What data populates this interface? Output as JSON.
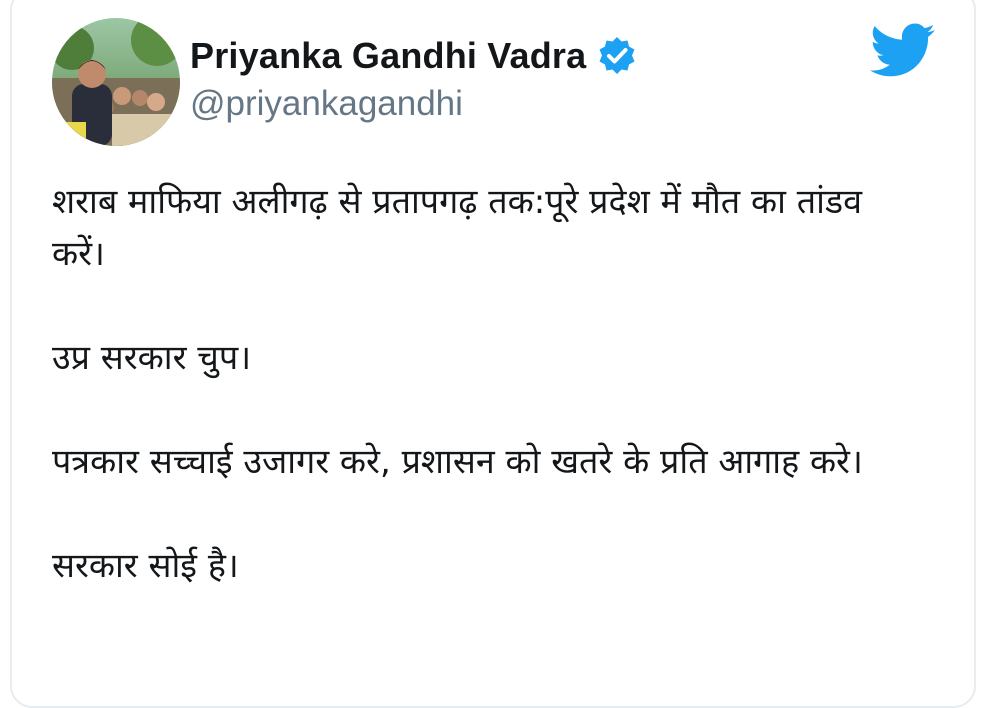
{
  "author": {
    "display_name": "Priyanka Gandhi Vadra",
    "handle": "@priyankagandhi",
    "verified": true,
    "avatar_icon": "profile-photo"
  },
  "brand": {
    "logo_icon": "twitter-bird-icon",
    "accent_color": "#1da1f2"
  },
  "tweet": {
    "paragraphs": [
      "शराब माफिया अलीगढ़ से प्रतापगढ़ तक:पूरे प्रदेश में मौत का तांडव करें।",
      "उप्र सरकार चुप।",
      "पत्रकार सच्चाई उजागर करे, प्रशासन को खतरे के प्रति आगाह करे।",
      "सरकार सोई है।"
    ]
  }
}
